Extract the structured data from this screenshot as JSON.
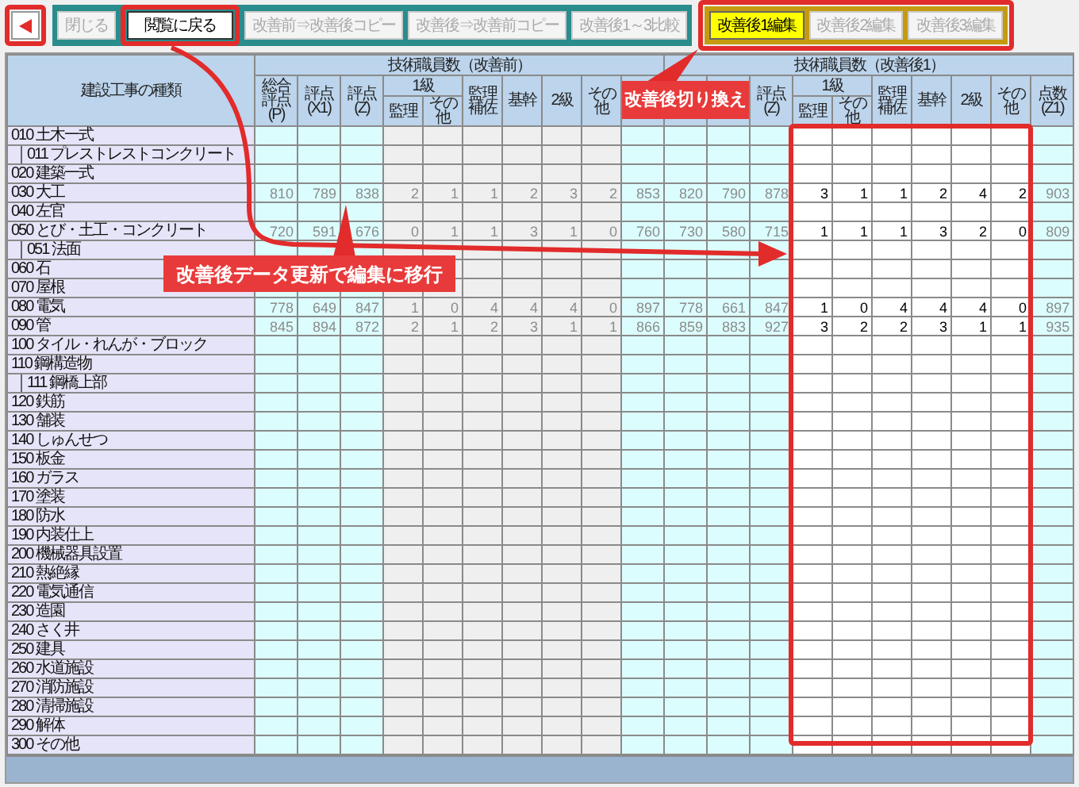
{
  "toolbar": {
    "buttons": [
      {
        "label": "閉じる",
        "disabled": true,
        "highlighted": false
      },
      {
        "label": "閲覧に戻る",
        "disabled": false,
        "highlighted": true
      },
      {
        "label": "改善前⇒改善後コピー",
        "disabled": true,
        "highlighted": false
      },
      {
        "label": "改善後⇒改善前コピー",
        "disabled": true,
        "highlighted": false
      },
      {
        "label": "改善後1～3比較",
        "disabled": true,
        "highlighted": false
      }
    ],
    "edit_group": {
      "highlighted": true,
      "buttons": [
        {
          "label": "改善後1編集",
          "selected": true
        },
        {
          "label": "改善後2編集",
          "selected": false
        },
        {
          "label": "改善後3編集",
          "selected": false
        }
      ]
    }
  },
  "table": {
    "name_header": "建設工事の種類",
    "groups": [
      {
        "title": "技術職員数（改善前）",
        "columns": [
          {
            "kind": "single",
            "label": "総合評点(P)"
          },
          {
            "kind": "single",
            "label": "評点(X1)"
          },
          {
            "kind": "single",
            "label": "評点(Z)"
          },
          {
            "kind": "split",
            "label": "1級",
            "sub": [
              "監理",
              "その他"
            ]
          },
          {
            "kind": "single",
            "label": "監理補佐"
          },
          {
            "kind": "single",
            "label": "基幹"
          },
          {
            "kind": "single",
            "label": "2級"
          },
          {
            "kind": "single",
            "label": "その他"
          },
          {
            "kind": "covered"
          }
        ]
      },
      {
        "title": "技術職員数（改善後1）",
        "columns": [
          {
            "kind": "covered"
          },
          {
            "kind": "covered"
          },
          {
            "kind": "single",
            "label": "評点(Z)"
          },
          {
            "kind": "split",
            "label": "1級",
            "sub": [
              "監理",
              "その他"
            ]
          },
          {
            "kind": "single",
            "label": "監理補佐"
          },
          {
            "kind": "single",
            "label": "基幹"
          },
          {
            "kind": "single",
            "label": "2級"
          },
          {
            "kind": "single",
            "label": "その他"
          },
          {
            "kind": "single",
            "label": "点数(Z1)"
          }
        ]
      }
    ],
    "rows": [
      {
        "name": "010 土木一式",
        "children": [
          {
            "name": "011 プレストレストコンクリート"
          }
        ]
      },
      {
        "name": "020 建築一式"
      },
      {
        "name": "030 大工",
        "values": [
          "810",
          "789",
          "838",
          "2",
          "1",
          "1",
          "2",
          "3",
          "2",
          "853",
          "820",
          "790",
          "878",
          "3",
          "1",
          "1",
          "2",
          "4",
          "2",
          "903"
        ]
      },
      {
        "name": "040 左官"
      },
      {
        "name": "050 とび・土工・コンクリート",
        "values": [
          "720",
          "591",
          "676",
          "0",
          "1",
          "1",
          "3",
          "1",
          "0",
          "760",
          "730",
          "580",
          "715",
          "1",
          "1",
          "1",
          "3",
          "2",
          "0",
          "809"
        ],
        "children": [
          {
            "name": "051 法面"
          }
        ]
      },
      {
        "name": "060 石"
      },
      {
        "name": "070 屋根"
      },
      {
        "name": "080 電気",
        "values": [
          "778",
          "649",
          "847",
          "1",
          "0",
          "4",
          "4",
          "4",
          "0",
          "897",
          "778",
          "661",
          "847",
          "1",
          "0",
          "4",
          "4",
          "4",
          "0",
          "897"
        ]
      },
      {
        "name": "090 管",
        "values": [
          "845",
          "894",
          "872",
          "2",
          "1",
          "2",
          "3",
          "1",
          "1",
          "866",
          "859",
          "883",
          "927",
          "3",
          "2",
          "2",
          "3",
          "1",
          "1",
          "935"
        ]
      },
      {
        "name": "100 タイル・れんが・ブロック"
      },
      {
        "name": "110 鋼構造物",
        "children": [
          {
            "name": "111 鋼橋上部"
          }
        ]
      },
      {
        "name": "120 鉄筋"
      },
      {
        "name": "130 舗装"
      },
      {
        "name": "140 しゅんせつ"
      },
      {
        "name": "150 板金"
      },
      {
        "name": "160 ガラス"
      },
      {
        "name": "170 塗装"
      },
      {
        "name": "180 防水"
      },
      {
        "name": "190 内装仕上"
      },
      {
        "name": "200 機械器具設置"
      },
      {
        "name": "210 熱絶縁"
      },
      {
        "name": "220 電気通信"
      },
      {
        "name": "230 造園"
      },
      {
        "name": "240 さく井"
      },
      {
        "name": "250 建具"
      },
      {
        "name": "260 水道施設"
      },
      {
        "name": "270 消防施設"
      },
      {
        "name": "280 清掃施設"
      },
      {
        "name": "290 解体"
      },
      {
        "name": "300 その他"
      }
    ]
  },
  "callouts": [
    {
      "text": "改善後切り換え"
    },
    {
      "text": "改善後データ更新で編集に移行"
    }
  ]
}
